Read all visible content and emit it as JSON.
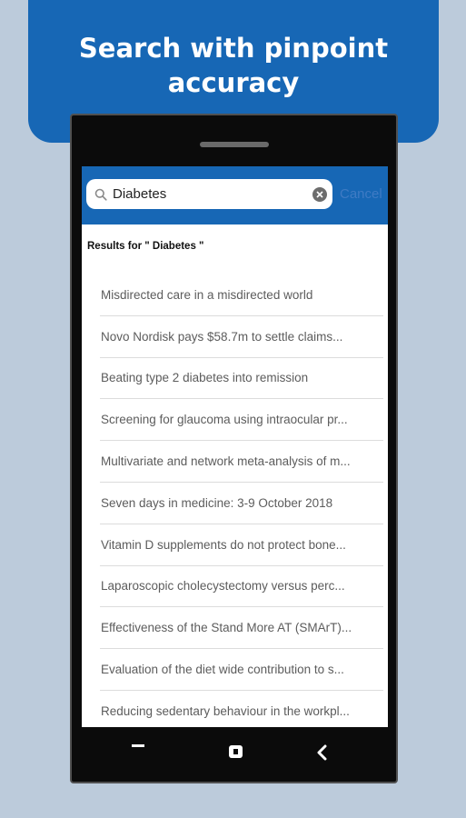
{
  "banner": {
    "headline": "Search with pinpoint accuracy"
  },
  "search": {
    "value": "Diabetes",
    "cancel_label": "Cancel"
  },
  "results": {
    "heading": "Results for \" Diabetes \"",
    "items": [
      "Misdirected care in a misdirected world",
      "Novo Nordisk pays $58.7m to settle claims...",
      "Beating type 2 diabetes into remission",
      "Screening for glaucoma using intraocular pr...",
      "Multivariate and network meta-analysis of m...",
      "Seven days in medicine: 3-9 October 2018",
      "Vitamin D supplements do not protect bone...",
      "Laparoscopic cholecystectomy versus perc...",
      "Effectiveness of the Stand More AT (SMArT)...",
      "Evaluation of the diet wide contribution to s...",
      "Reducing sedentary behaviour in the workpl..."
    ]
  },
  "colors": {
    "brand": "#1767b5",
    "background": "#bccbdb"
  },
  "icons": [
    "search-icon",
    "clear-icon",
    "recent-apps-icon",
    "home-icon",
    "back-icon"
  ]
}
